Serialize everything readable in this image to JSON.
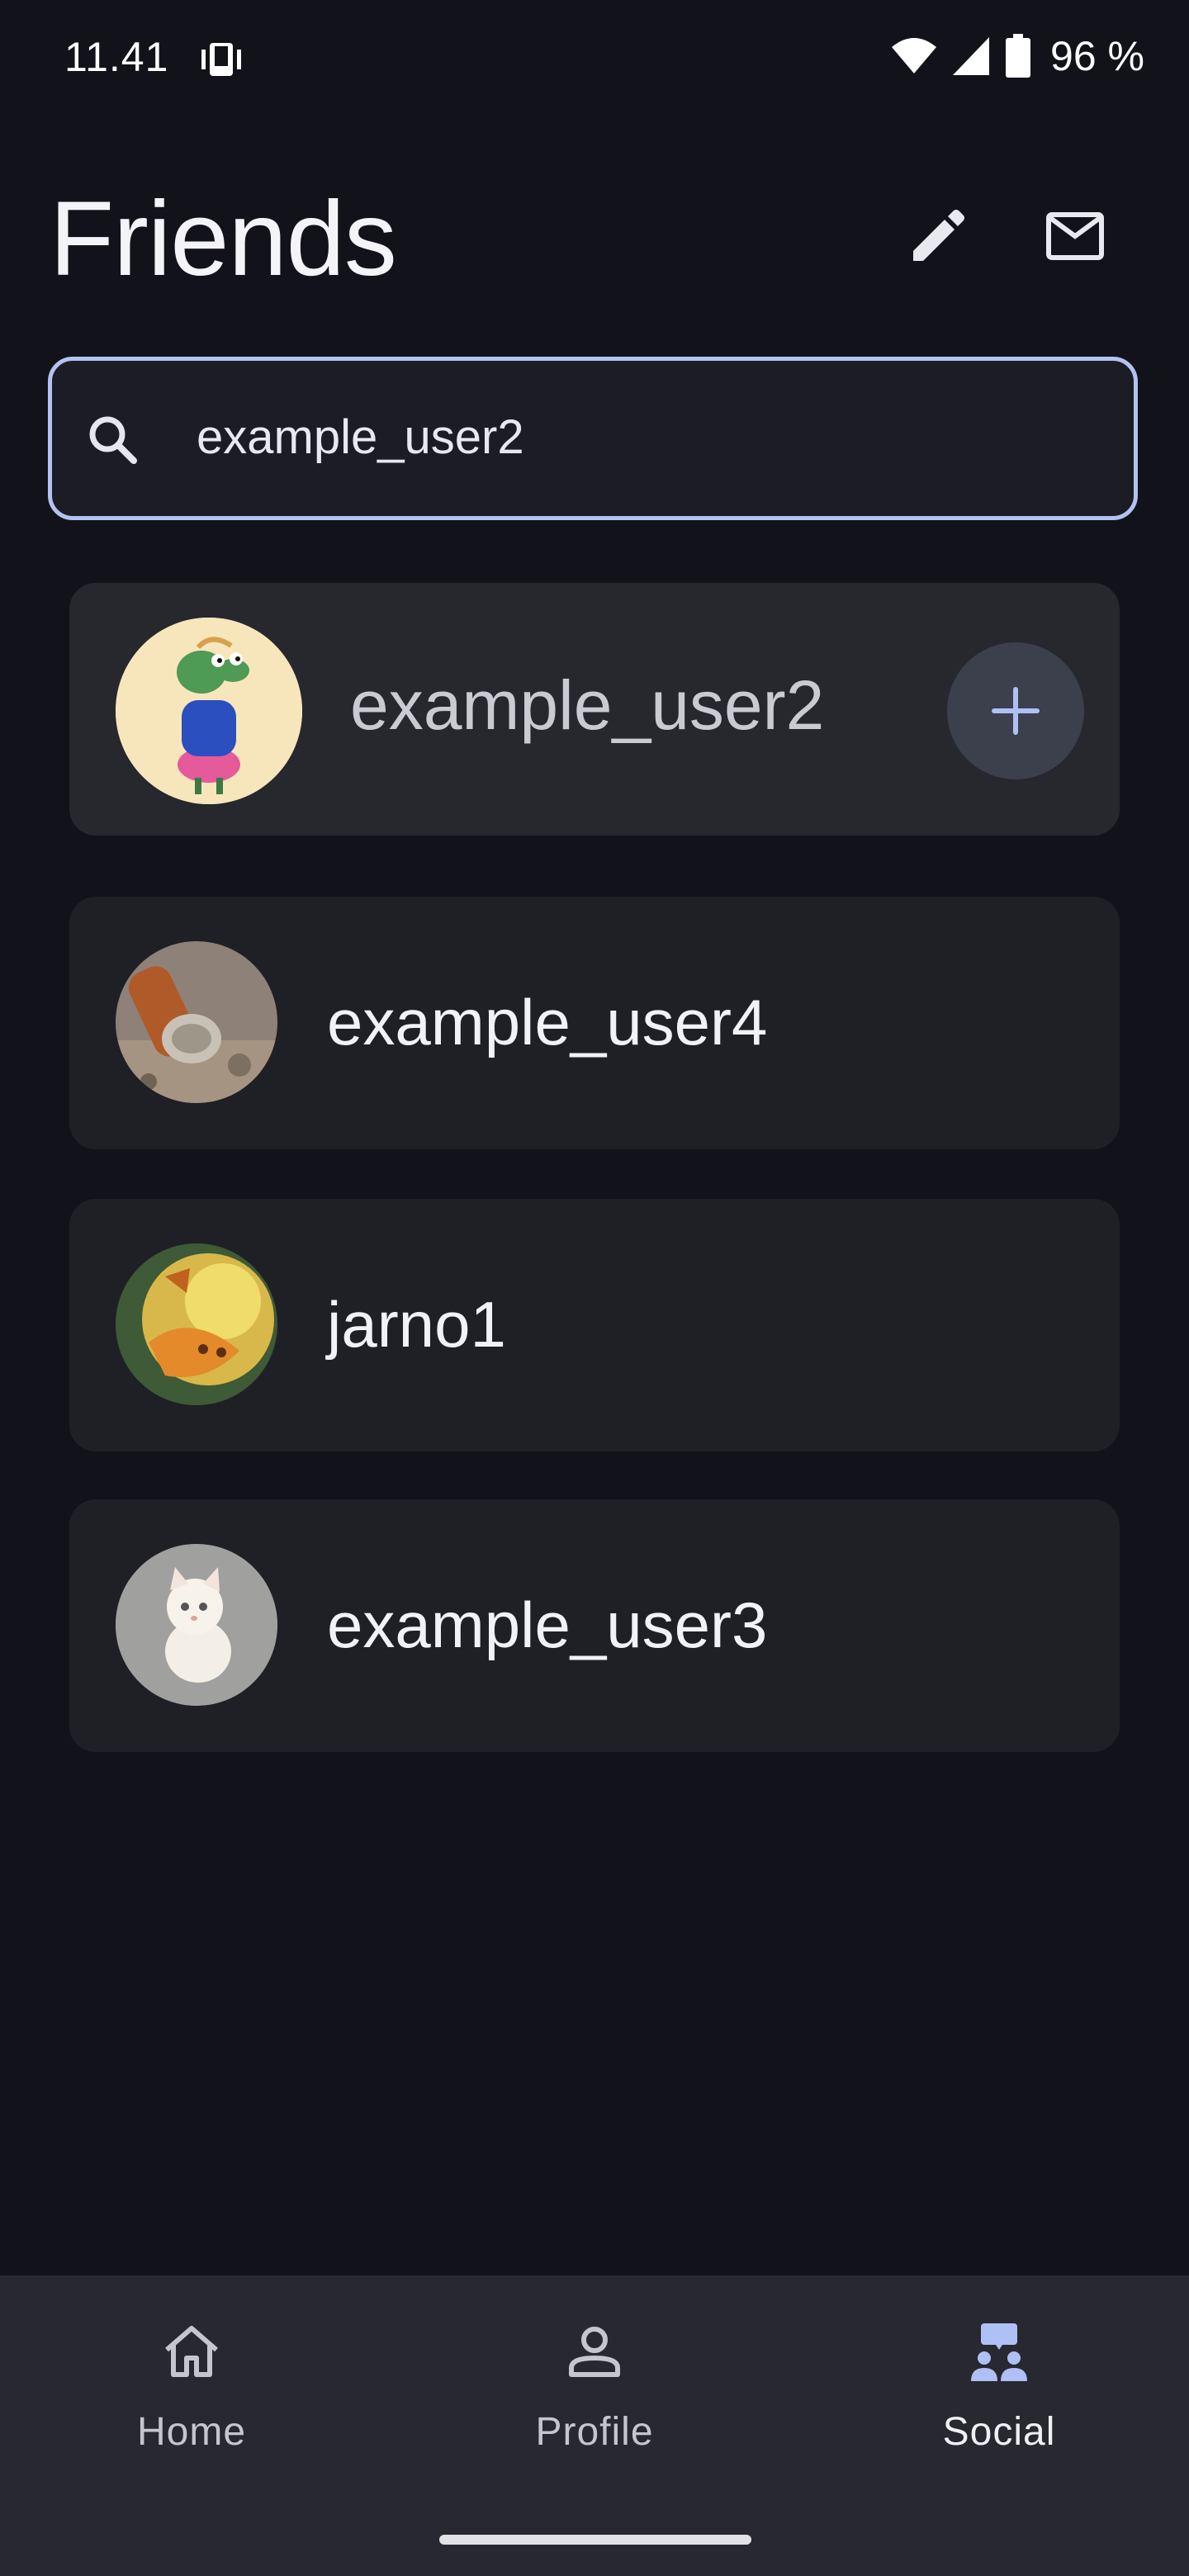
{
  "status_bar": {
    "time": "11.41",
    "battery": "96 %"
  },
  "header": {
    "title": "Friends",
    "edit_icon": "pencil-icon",
    "mail_icon": "mail-icon"
  },
  "search": {
    "value": "example_user2",
    "icon": "search-icon",
    "border_color": "#b3c2f1"
  },
  "results": [
    {
      "name": "example_user2",
      "action": "add-friend",
      "action_icon": "plus-icon",
      "highlighted": true
    },
    {
      "name": "example_user4"
    },
    {
      "name": "jarno1"
    },
    {
      "name": "example_user3"
    }
  ],
  "nav": {
    "items": [
      {
        "label": "Home",
        "icon": "home-icon"
      },
      {
        "label": "Profile",
        "icon": "person-icon"
      },
      {
        "label": "Social",
        "icon": "social-icon",
        "active": true
      }
    ]
  },
  "colors": {
    "background": "#12131a",
    "card": "#1f2026",
    "accent": "#aec0f5",
    "nav_bar": "#272830"
  }
}
